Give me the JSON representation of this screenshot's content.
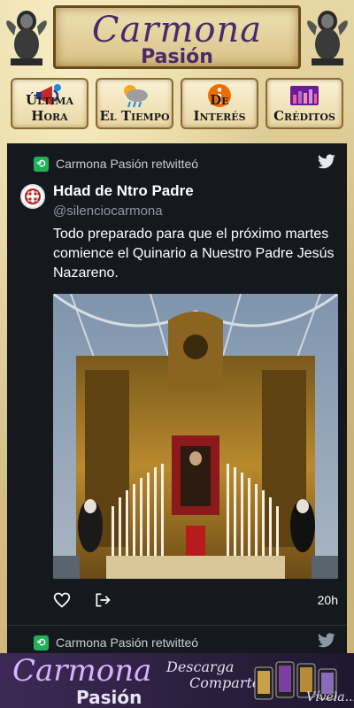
{
  "header": {
    "title": "Carmona",
    "subtitle": "Pasión"
  },
  "nav": [
    {
      "label": "Última Hora",
      "icon": "megaphone-icon"
    },
    {
      "label": "El Tiempo",
      "icon": "weather-icon"
    },
    {
      "label": "De Interés",
      "icon": "info-icon"
    },
    {
      "label": "Créditos",
      "icon": "credits-icon"
    }
  ],
  "tweets": [
    {
      "retweet_text": "Carmona Pasión retwitteó",
      "name": "Hdad de Ntro Padre",
      "handle": "@silenciocarmona",
      "text": "Todo preparado para que el próximo martes comience el Quinario a Nuestro Padre Jesús Nazareno.",
      "time": "20h",
      "icons": {
        "retweet": "retweet-icon",
        "bird": "twitter-bird-icon",
        "like": "heart-icon",
        "share": "share-icon"
      }
    },
    {
      "retweet_text": "Carmona Pasión retwitteó"
    }
  ],
  "footer": {
    "title": "Carmona",
    "subtitle": "Pasión",
    "slogan_1": "Descarga",
    "slogan_2": "Comparte",
    "slogan_3": "Vívela..!"
  },
  "colors": {
    "accent": "#4a2b6a",
    "timeline_bg": "#15181c",
    "retweet_green": "#1fb05a",
    "twitter_blue": "#1d9bf0"
  }
}
